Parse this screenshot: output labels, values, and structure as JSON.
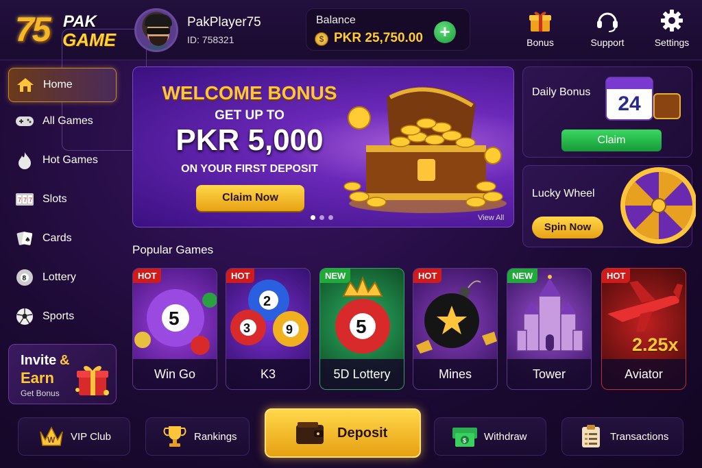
{
  "header": {
    "logo": {
      "num": "75",
      "pak": "PAK",
      "game": "GAME"
    },
    "user": {
      "name": "PakPlayer75",
      "id": "ID: 758321"
    },
    "balance": {
      "label": "Balance",
      "amount": "PKR 25,750.00"
    },
    "actions": [
      {
        "label": "Bonus",
        "icon": "gift-icon"
      },
      {
        "label": "Support",
        "icon": "headset-icon"
      },
      {
        "label": "Settings",
        "icon": "gear-icon"
      }
    ]
  },
  "sidebar": {
    "items": [
      {
        "label": "Home",
        "icon": "home-icon",
        "active": true
      },
      {
        "label": "All Games",
        "icon": "gamepad-icon"
      },
      {
        "label": "Hot Games",
        "icon": "flame-icon"
      },
      {
        "label": "Slots",
        "icon": "slots-icon"
      },
      {
        "label": "Cards",
        "icon": "cards-icon"
      },
      {
        "label": "Lottery",
        "icon": "lottery-ball-icon"
      },
      {
        "label": "Sports",
        "icon": "soccer-ball-icon"
      }
    ],
    "invite": {
      "line1": "Invite",
      "amp": "&",
      "line2": "Earn",
      "cta": "Get Bonus"
    }
  },
  "banner": {
    "title": "WELCOME BONUS",
    "sub": "GET UP TO",
    "amount": "PKR 5,000",
    "desc": "ON YOUR FIRST DEPOSIT",
    "cta": "Claim Now",
    "view_all": "View All"
  },
  "daily_bonus": {
    "title": "Daily Bonus",
    "day": "24",
    "cta": "Claim"
  },
  "lucky_wheel": {
    "title": "Lucky Wheel",
    "cta": "Spin Now"
  },
  "popular": {
    "title": "Popular Games",
    "games": [
      {
        "name": "Win Go",
        "badge": "HOT"
      },
      {
        "name": "K3",
        "badge": "HOT"
      },
      {
        "name": "5D Lottery",
        "badge": "NEW"
      },
      {
        "name": "Mines",
        "badge": "HOT"
      },
      {
        "name": "Tower",
        "badge": "NEW"
      },
      {
        "name": "Aviator",
        "badge": "HOT",
        "multiplier": "2.25x"
      }
    ]
  },
  "bottom": {
    "vip": "VIP Club",
    "rankings": "Rankings",
    "deposit": "Deposit",
    "withdraw": "Withdraw",
    "transactions": "Transactions"
  },
  "colors": {
    "accent": "#f5b829",
    "hot": "#d11a1a",
    "new": "#1faa3a",
    "bg": "#1a0b2e"
  }
}
